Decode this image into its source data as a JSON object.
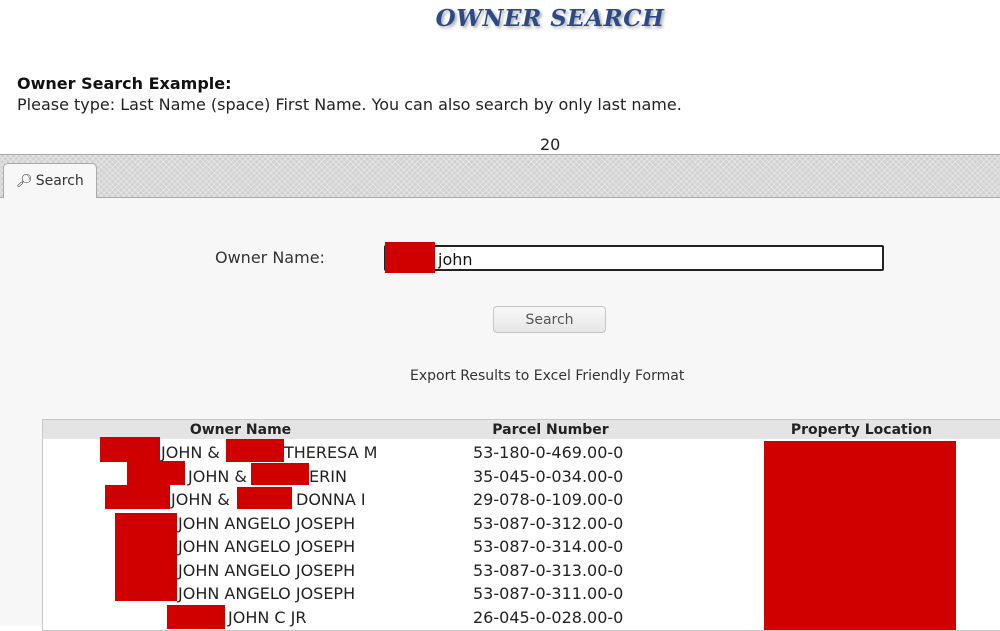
{
  "page": {
    "title": "OWNER SEARCH",
    "example_heading": "Owner Search Example:",
    "example_text": "Please type: Last Name (space) First Name. You can also search by only last name.",
    "result_count": "20"
  },
  "tabs": [
    {
      "label": "Search",
      "icon": "search-icon"
    }
  ],
  "form": {
    "owner_label": "Owner Name:",
    "owner_value": "john",
    "search_label": "Search",
    "export_label": "Export Results to Excel Friendly Format"
  },
  "colors": {
    "title": "#2c4a86",
    "redaction": "#d10000"
  },
  "table": {
    "headers": [
      "Owner Name",
      "Parcel Number",
      "Property Location"
    ],
    "rows": [
      {
        "owner_a": "JOHN &",
        "owner_b": "THERESA M",
        "parcel": "53-180-0-469.00-0"
      },
      {
        "owner_a": "JOHN &",
        "owner_b": "ERIN",
        "parcel": "35-045-0-034.00-0"
      },
      {
        "owner_a": "JOHN &",
        "owner_b": "DONNA I",
        "parcel": "29-078-0-109.00-0"
      },
      {
        "owner_a": "JOHN ANGELO JOSEPH",
        "parcel": "53-087-0-312.00-0"
      },
      {
        "owner_a": "JOHN ANGELO JOSEPH",
        "parcel": "53-087-0-314.00-0"
      },
      {
        "owner_a": "JOHN ANGELO JOSEPH",
        "parcel": "53-087-0-313.00-0"
      },
      {
        "owner_a": "JOHN ANGELO JOSEPH",
        "parcel": "53-087-0-311.00-0"
      },
      {
        "owner_a": "JOHN C JR",
        "parcel": "26-045-0-028.00-0"
      }
    ]
  }
}
